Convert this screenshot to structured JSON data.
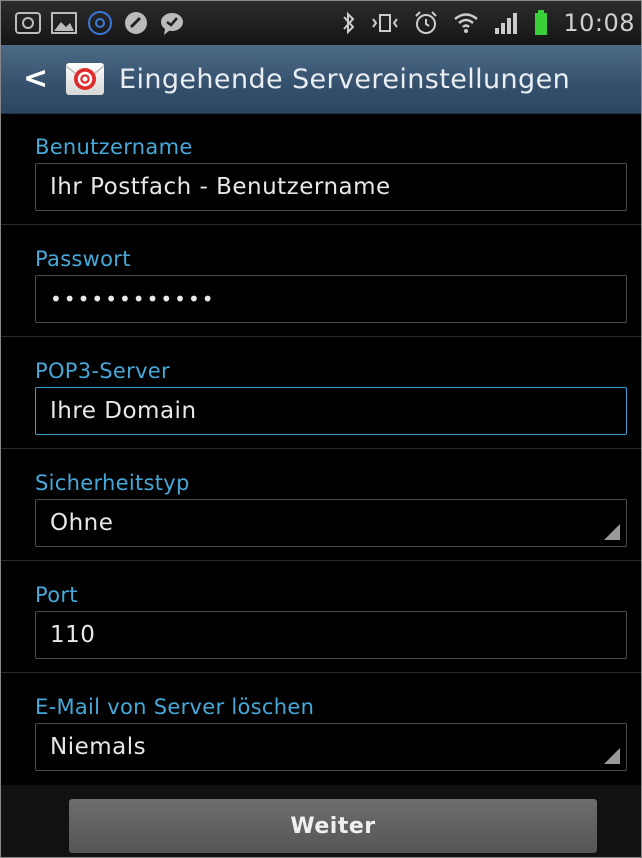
{
  "status_bar": {
    "time": "10:08",
    "left_icons": [
      "gallery-notification-icon",
      "image-icon",
      "email-notification-icon",
      "tools-icon",
      "chat-bubble-icon"
    ],
    "right_icons": [
      "bluetooth-icon",
      "vibrate-icon",
      "alarm-icon",
      "wifi-icon",
      "signal-icon",
      "battery-icon"
    ],
    "battery_color": "#39d03a"
  },
  "action_bar": {
    "title": "Eingehende Servereinstellungen",
    "back_glyph": "<"
  },
  "form": {
    "username_label": "Benutzername",
    "username_value": "Ihr Postfach - Benutzername",
    "password_label": "Passwort",
    "password_value": "••••••••••••",
    "server_label": "POP3-Server",
    "server_value": "Ihre Domain",
    "security_label": "Sicherheitstyp",
    "security_value": "Ohne",
    "port_label": "Port",
    "port_value": "110",
    "delete_label": "E-Mail von Server löschen",
    "delete_value": "Niemals"
  },
  "buttons": {
    "next_label": "Weiter"
  },
  "colors": {
    "label_accent": "#45a8d8",
    "focus_border": "#3a9ed0",
    "action_bar": "#3b5875"
  }
}
